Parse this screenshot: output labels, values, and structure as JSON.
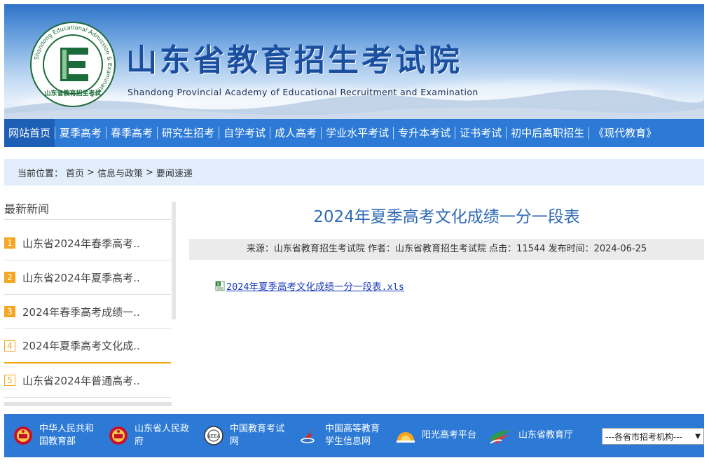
{
  "header": {
    "title": "山东省教育招生考试院",
    "subtitle": "Shandong Provincial Academy of Educational Recruitment and Examination",
    "seal_text_outer": "Shandong Educational Admission & Examinations",
    "seal_text_inner": "山东省教育招生考试院"
  },
  "nav": {
    "items": [
      {
        "label": "网站首页"
      },
      {
        "label": "夏季高考"
      },
      {
        "label": "春季高考"
      },
      {
        "label": "研究生招考"
      },
      {
        "label": "自学考试"
      },
      {
        "label": "成人高考"
      },
      {
        "label": "学业水平考试"
      },
      {
        "label": "专升本考试"
      },
      {
        "label": "证书考试"
      },
      {
        "label": "初中后高职招生"
      },
      {
        "label": "《现代教育》"
      }
    ],
    "active_index": 0
  },
  "breadcrumb": {
    "prefix": "当前位置：",
    "items": [
      "首页",
      "信息与政策",
      "要闻速递"
    ],
    "separator": ">"
  },
  "sidebar": {
    "heading": "最新新闻",
    "items": [
      {
        "num": "1",
        "text": "山东省2024年春季高考.."
      },
      {
        "num": "2",
        "text": "山东省2024年夏季高考.."
      },
      {
        "num": "3",
        "text": "2024年春季高考成绩一.."
      },
      {
        "num": "4",
        "text": "2024年夏季高考文化成.."
      },
      {
        "num": "5",
        "text": "山东省2024年普通高考.."
      }
    ],
    "active_index": 3
  },
  "article": {
    "title": "2024年夏季高考文化成绩一分一段表",
    "meta": "来源：山东省教育招生考试院 作者：山东省教育招生考试院 点击：11544 发布时间：2024-06-25",
    "attachment": "2024年夏季高考文化成绩一分一段表.xls"
  },
  "footer": {
    "links": [
      {
        "line1": "中华人民共和",
        "line2": "国教育部",
        "icon": "national-emblem-icon"
      },
      {
        "line1": "山东省人民政",
        "line2": "府",
        "icon": "national-emblem-icon"
      },
      {
        "line1": "中国教育考试",
        "line2": "网",
        "icon": "exam-center-icon"
      },
      {
        "line1": "中国高等教育",
        "line2": "学生信息网",
        "icon": "chsi-icon"
      },
      {
        "line1": "阳光高考平台",
        "line2": "",
        "icon": "sunshine-icon"
      },
      {
        "line1": "山东省教育厅",
        "line2": "",
        "icon": "education-dept-icon"
      }
    ],
    "select_value": "---各省市招考机构---"
  },
  "colors": {
    "nav": "#2c7ad6",
    "nav_active": "#1d5fb5",
    "title_blue": "#2f6ab4",
    "badge": "#f5a623"
  }
}
